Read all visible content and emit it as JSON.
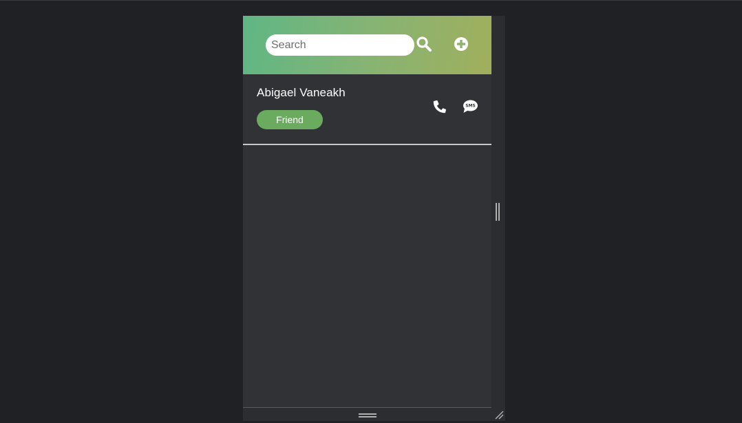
{
  "search": {
    "placeholder": "Search",
    "value": "",
    "search_icon": "search-icon",
    "add_icon": "plus-circle-icon"
  },
  "contacts": [
    {
      "name": "Abigael Vaneakh",
      "tag": "Friend",
      "tag_color": "#6aab5f",
      "call_icon": "phone-icon",
      "sms_icon": "sms-icon",
      "sms_icon_text": "SMS"
    }
  ],
  "colors": {
    "page_background": "#202124",
    "panel_background": "#303236",
    "header_gradient_start": "#5fb685",
    "header_gradient_end": "#a0af5c",
    "divider": "#c8c8c8"
  }
}
